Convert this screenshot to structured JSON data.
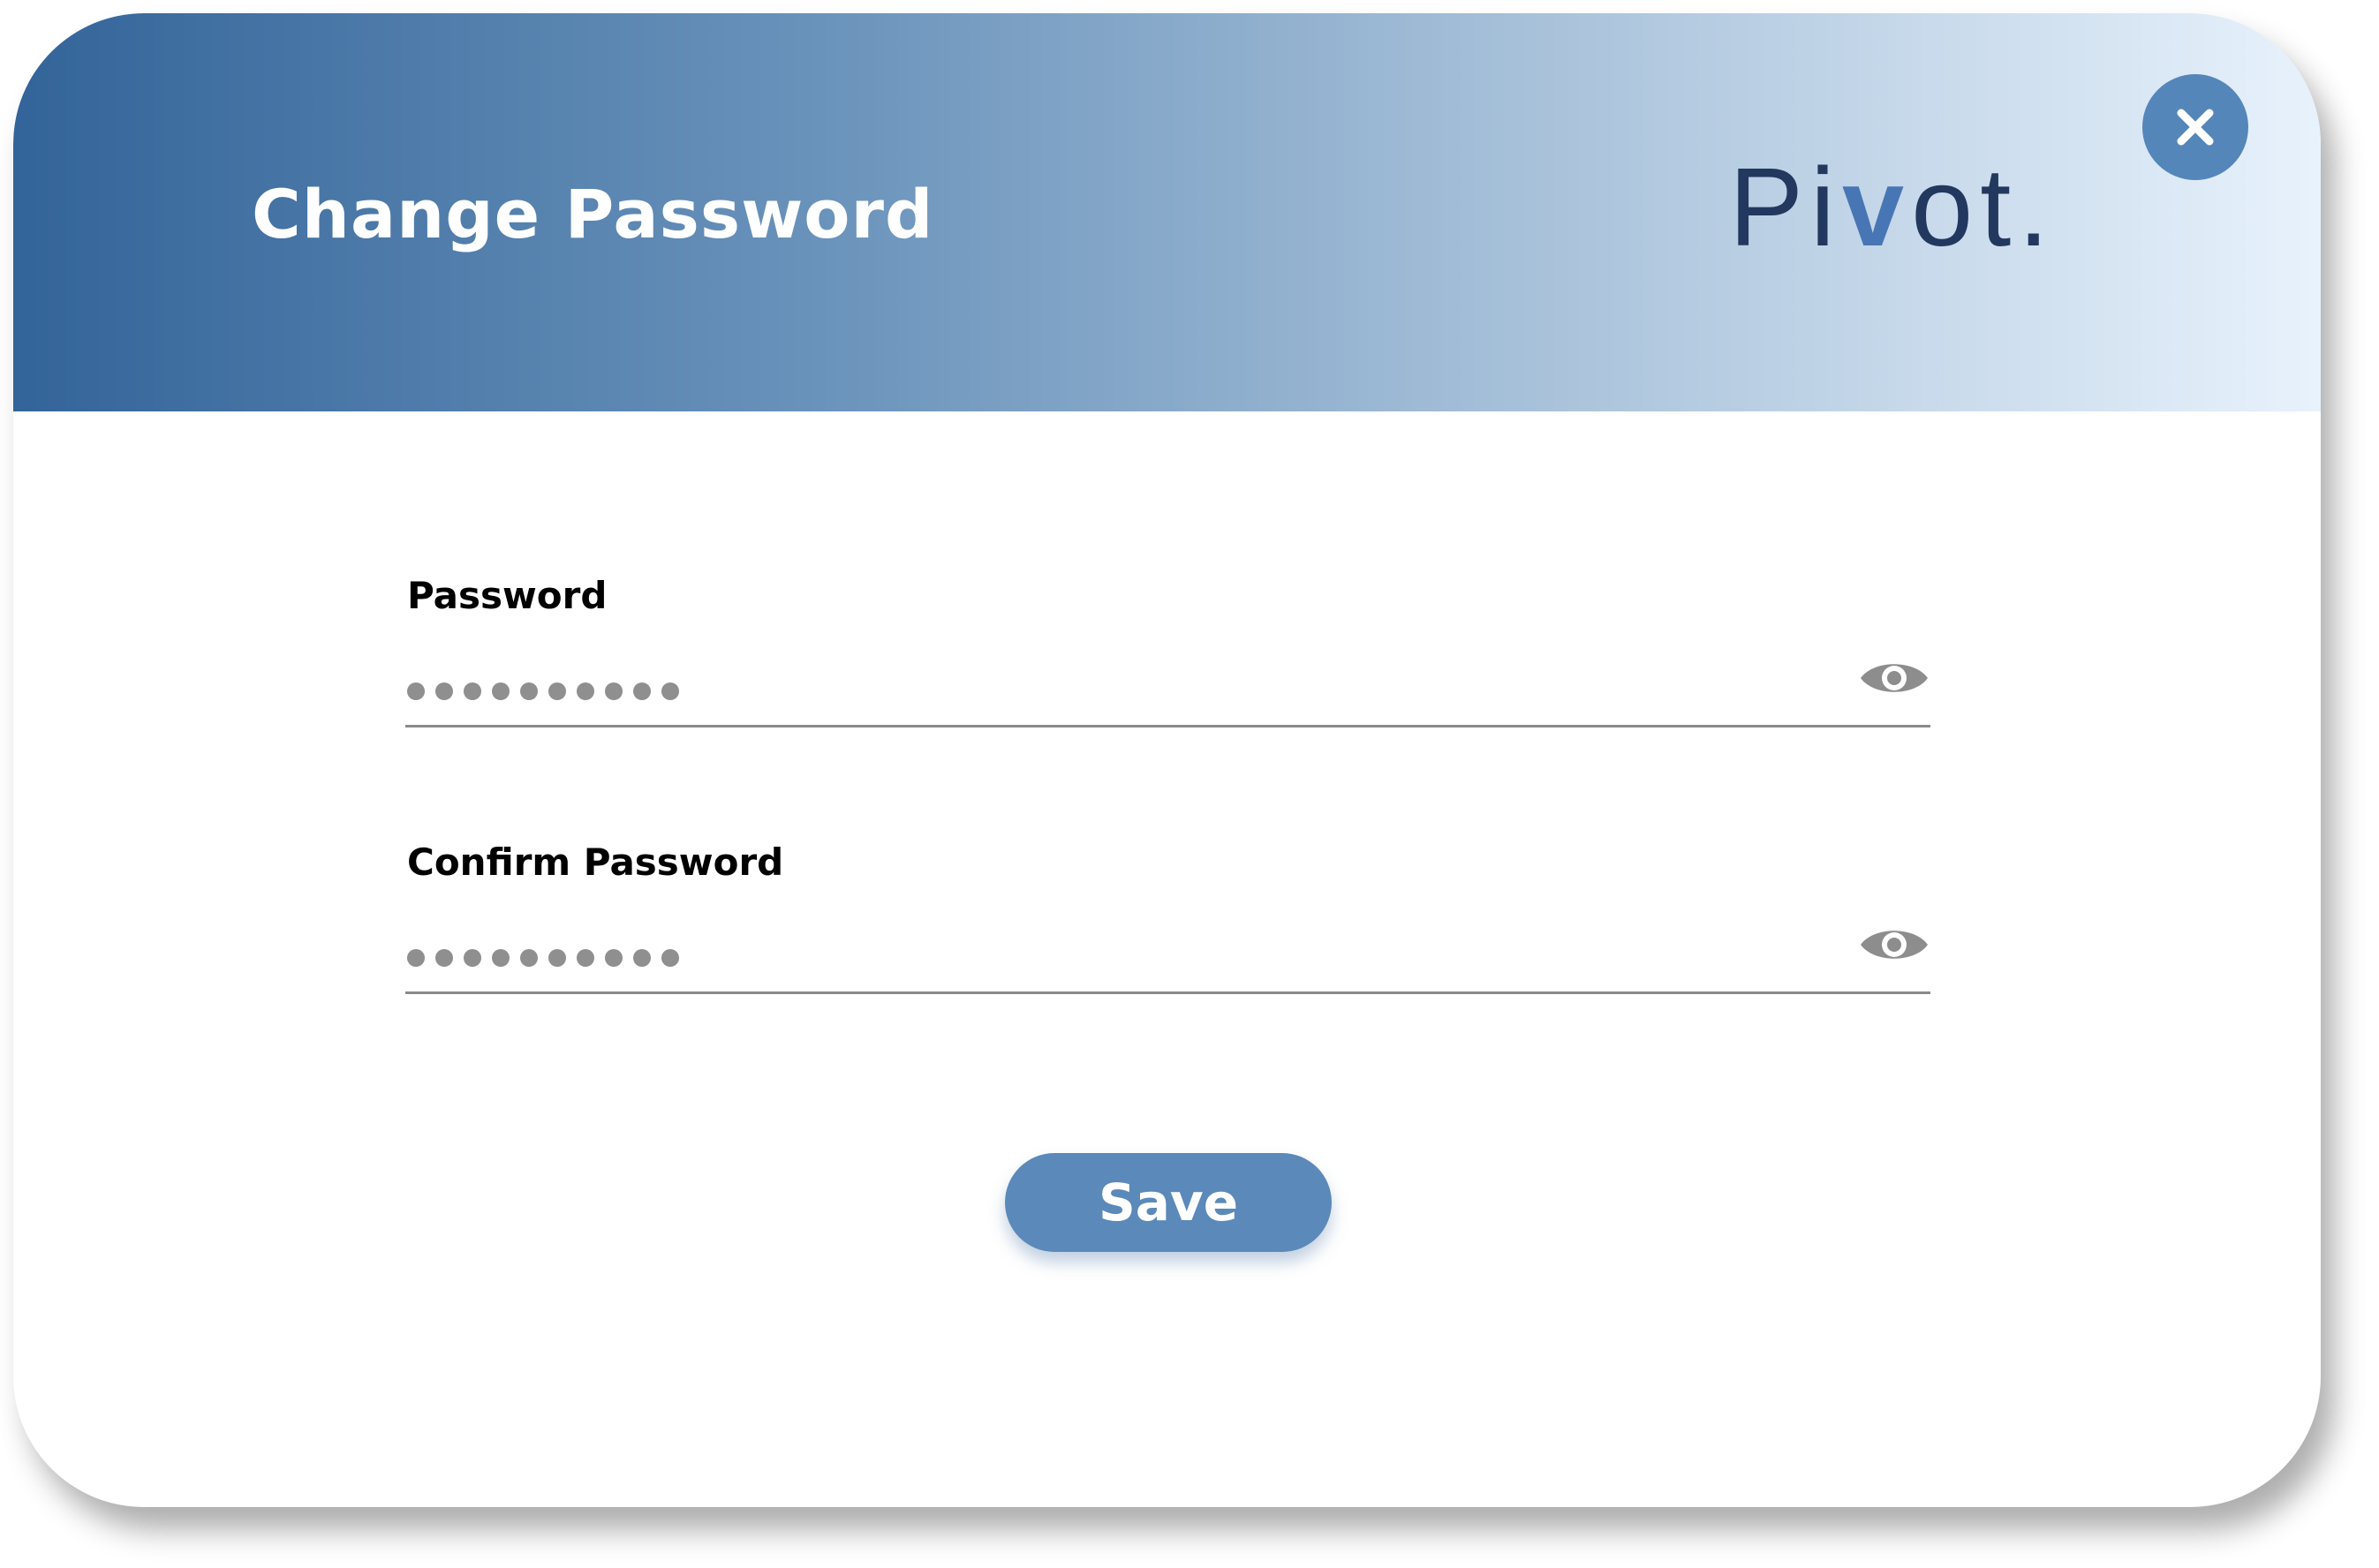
{
  "dialog": {
    "title": "Change Password",
    "brand": {
      "prefix": "Pi",
      "accent": "v",
      "suffix": "ot."
    },
    "close_icon": "close-icon"
  },
  "fields": [
    {
      "label": "Password",
      "masked_value": "••••••••••",
      "mask_length": 10,
      "toggle_icon": "eye-icon"
    },
    {
      "label": "Confirm Password",
      "masked_value": "••••••••••",
      "mask_length": 10,
      "toggle_icon": "eye-icon"
    }
  ],
  "save_button": {
    "label": "Save"
  },
  "colors": {
    "header_gradient_start": "#336499",
    "header_gradient_end": "#e8f2fc",
    "brand_text": "#23385f",
    "brand_accent": "#4876b4",
    "button_bg": "#5b89b9",
    "close_bg": "#5486ba"
  }
}
